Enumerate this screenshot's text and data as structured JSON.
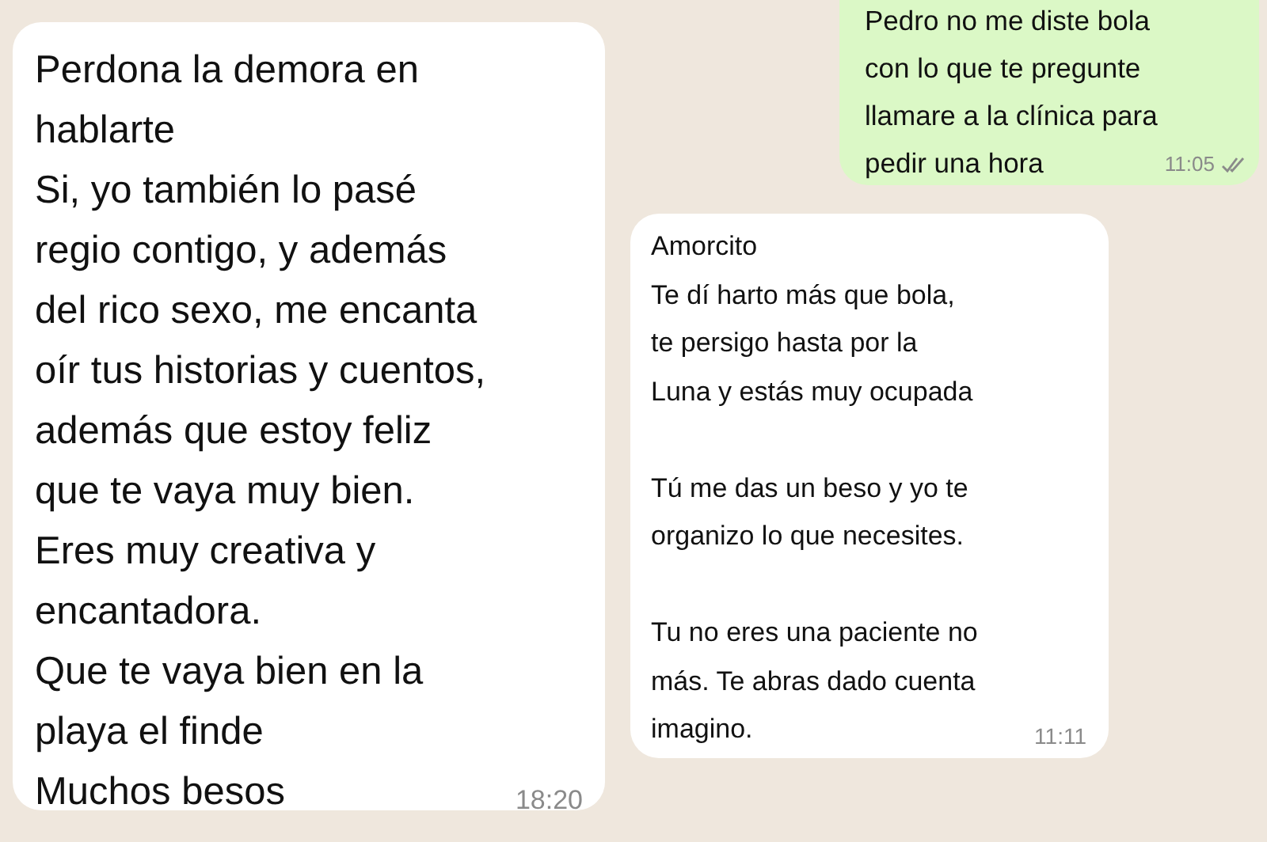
{
  "messages": [
    {
      "kind": "incoming",
      "text": "Perdona la demora en\nhablarte\nSi, yo también lo pasé\nregio contigo, y además\ndel rico sexo, me encanta\noír tus historias y cuentos,\nademás que estoy feliz\nque te vaya muy bien.\nEres muy creativa y\nencantadora.\nQue te vaya bien en la\nplaya el finde\nMuchos besos",
      "time": "18:20",
      "read": false
    },
    {
      "kind": "outgoing",
      "text": "Pedro no me diste bola\ncon lo que te pregunte\nllamare a la clínica para\npedir una hora",
      "time": "11:05",
      "read": true
    },
    {
      "kind": "incoming",
      "text": "Amorcito\nTe dí harto más que bola,\nte persigo hasta por la\nLuna y estás muy ocupada\n\nTú me das un beso y yo te\norganizo lo que necesites.\n\nTu no eres una paciente no\nmás. Te abras dado cuenta\nimagino.",
      "time": "11:11",
      "read": false
    }
  ]
}
